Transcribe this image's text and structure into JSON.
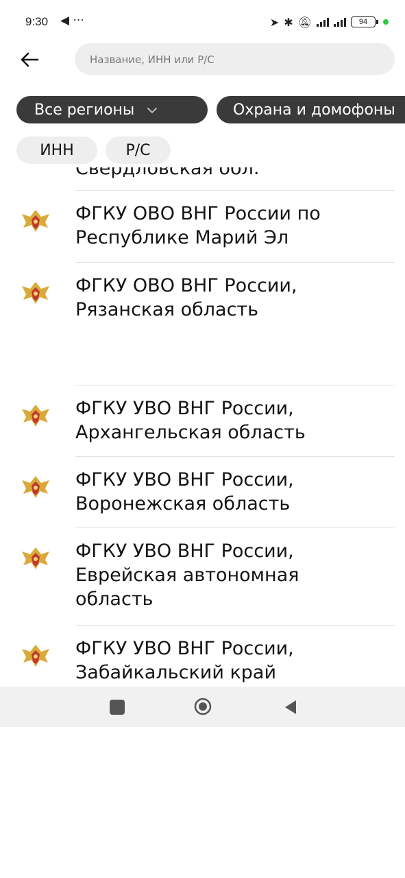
{
  "status_bar": {
    "time": "9:30",
    "left_icons": "◀ ···",
    "battery": "94"
  },
  "search": {
    "placeholder": "Название, ИНН или Р/С",
    "value": ""
  },
  "filters": {
    "regions_label": "Все регионы",
    "category_label": "Охрана и домофоны"
  },
  "tabs": {
    "inn_label": "ИНН",
    "rs_label": "Р/С"
  },
  "list": {
    "clipped_top_text": "Свердловская обл.",
    "items": [
      {
        "name": "ФГКУ ОВО ВНГ России по\nРеспублике Марий Эл"
      },
      {
        "name": "ФГКУ ОВО ВНГ России,\nРязанская область"
      },
      {
        "name": "ФГКУ УВО ВНГ России,\nАрхангельская область"
      },
      {
        "name": "ФГКУ УВО ВНГ России,\nВоронежская область"
      },
      {
        "name": "ФГКУ УВО ВНГ России,\nЕврейская автономная\nобласть"
      },
      {
        "name": "ФГКУ УВО ВНГ России,\nЗабайкальский край"
      }
    ]
  },
  "colors": {
    "chip_dark": "#3a3a3a",
    "chip_light": "#eeeeee",
    "emblem_gold": "#d9a93a",
    "emblem_red": "#c0392b",
    "nav_bg": "#f1f1f1"
  }
}
